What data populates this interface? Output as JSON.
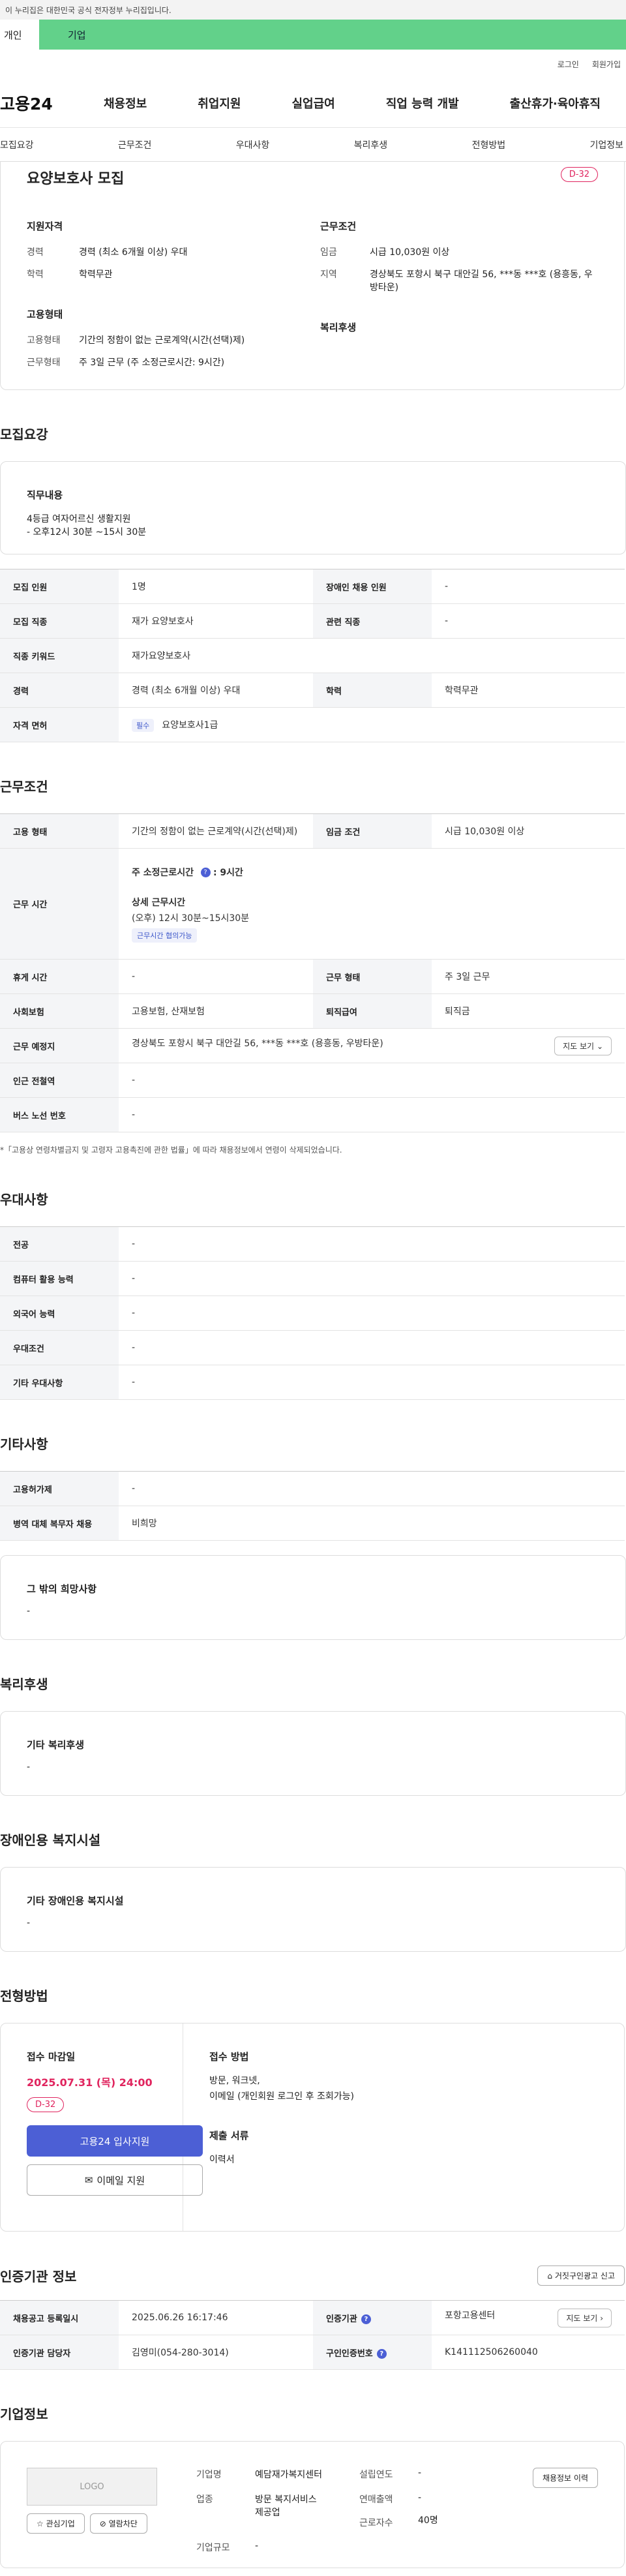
{
  "gov_banner": "이 누리집은 대한민국 공식 전자정부 누리집입니다.",
  "tabs": [
    "개인",
    "기업"
  ],
  "util": [
    "로그인",
    "회원가입"
  ],
  "logo": "고용24",
  "gnb": [
    "채용정보",
    "취업지원",
    "실업급여",
    "직업 능력 개발",
    "출산휴가·육아휴직"
  ],
  "subnav": [
    "모집요강",
    "근무조건",
    "우대사항",
    "복리후생",
    "전형방법",
    "기업정보"
  ],
  "job": {
    "title": "요양보호사 모집",
    "dday": "D-32",
    "qual_h": "지원자격",
    "qual": [
      {
        "k": "경력",
        "v": "경력 (최소 6개월 이상) 우대"
      },
      {
        "k": "학력",
        "v": "학력무관"
      }
    ],
    "cond_h": "근무조건",
    "cond": [
      {
        "k": "임금",
        "v": "시급 10,030원 이상"
      },
      {
        "k": "지역",
        "v": "경상북도 포항시 북구 대안길 56, ***동 ***호 (용흥동, 우방타운)"
      }
    ],
    "emp_h": "고용형태",
    "emp": [
      {
        "k": "고용형태",
        "v": "기간의 정함이 없는 근로계약(시간(선택)제)"
      },
      {
        "k": "근무형태",
        "v": "주 3일 근무 (주 소정근로시간: 9시간)"
      }
    ],
    "welfare_h": "복리후생"
  },
  "recruit": {
    "title": "모집요강",
    "duty_h": "직무내용",
    "duty_lines": [
      "4등급 여자어르신 생활지원",
      "- 오후12시 30분 ~15시 30분"
    ],
    "rows": [
      {
        "k1": "모집 인원",
        "v1": "1명",
        "k2": "장애인 채용 인원",
        "v2": "-"
      },
      {
        "k1": "모집 직종",
        "v1": "재가 요양보호사",
        "k2": "관련 직종",
        "v2": "-"
      },
      {
        "k1": "직종 키워드",
        "v1": "재가요양보호사"
      },
      {
        "k1": "경력",
        "v1": "경력 (최소 6개월 이상) 우대",
        "k2": "학력",
        "v2": "학력무관"
      },
      {
        "k1": "자격 면허",
        "badge": "필수",
        "v1": "요양보호사1급"
      }
    ]
  },
  "work": {
    "title": "근무조건",
    "emp_k": "고용 형태",
    "emp_v": "기간의 정함이 없는 근로계약(시간(선택)제)",
    "wage_k": "임금 조건",
    "wage_v": "시급 10,030원 이상",
    "time_k": "근무 시간",
    "time_a": "주 소정근로시간",
    "time_a_v": ": 9시간",
    "time_b": "상세 근무시간",
    "time_b_v": "(오후) 12시 30분~15시30분",
    "time_tag": "근무시간 협의가능",
    "rest_k": "휴게 시간",
    "rest_v": "-",
    "form_k": "근무 형태",
    "form_v": "주 3일 근무",
    "ins_k": "사회보험",
    "ins_v": "고용보험, 산재보험",
    "sev_k": "퇴직급여",
    "sev_v": "퇴직금",
    "loc_k": "근무 예정지",
    "loc_v": "경상북도 포항시 북구 대안길 56, ***동 ***호 (용흥동, 우방타운)",
    "map_btn": "지도 보기",
    "sub_k": "인근 전철역",
    "sub_v": "-",
    "bus_k": "버스 노선 번호",
    "bus_v": "-",
    "note": "*「고용상 연령차별금지 및 고령자 고용촉진에 관한 법률」에 따라 채용정보에서 연령이 삭제되었습니다."
  },
  "pref": {
    "title": "우대사항",
    "rows": [
      {
        "k": "전공",
        "v": "-"
      },
      {
        "k": "컴퓨터 활용 능력",
        "v": "-"
      },
      {
        "k": "외국어 능력",
        "v": "-"
      },
      {
        "k": "우대조건",
        "v": "-"
      },
      {
        "k": "기타 우대사항",
        "v": "-"
      }
    ]
  },
  "etc": {
    "title": "기타사항",
    "rows": [
      {
        "k": "고용허가제",
        "v": "-"
      },
      {
        "k": "병역 대체 복무자 채용",
        "v": "비희망"
      }
    ],
    "box_h": "그 밖의 희망사항",
    "box_v": "-"
  },
  "welfare": {
    "title": "복리후생",
    "box_h": "기타 복리후생",
    "box_v": "-"
  },
  "disab": {
    "title": "장애인용 복지시설",
    "box_h": "기타 장애인용 복지시설",
    "box_v": "-"
  },
  "process": {
    "title": "전형방법",
    "deadline_h": "접수 마감일",
    "deadline": "2025.07.31 (목) 24:00",
    "dday": "D-32",
    "apply_btn": "고용24 입사지원",
    "mail_btn": "이메일 지원",
    "method_h": "접수 방법",
    "method_lines": [
      "방문, 워크넷,",
      "이메일 (개인회원 로그인 후 조회가능)"
    ],
    "docs_h": "제출 서류",
    "docs_v": "이력서"
  },
  "agency": {
    "title": "인증기관 정보",
    "report_btn": "거짓구인광고 신고",
    "r1": {
      "k1": "채용공고 등록일시",
      "v1": "2025.06.26 16:17:46",
      "k2": "인증기관",
      "v2": "포항고용센터",
      "btn": "지도 보기"
    },
    "r2": {
      "k1": "인증기관 담당자",
      "v1": "김영미(054-280-3014)",
      "k2": "구인인증번호",
      "v2": "K141112506260040"
    }
  },
  "company": {
    "title": "기업정보",
    "logo": "LOGO",
    "fav_btn": "관심기업",
    "block_btn": "열람차단",
    "name_k": "기업명",
    "name_v": "예담재가복지센터",
    "year_k": "설립연도",
    "year_v": "-",
    "ind_k": "업종",
    "ind_lines": [
      "방문 복지서비스",
      "제공업"
    ],
    "sales_k": "연매출액",
    "sales_v": "-",
    "emp_k": "근로자수",
    "emp_v": "40명",
    "size_k": "기업규모",
    "size_v": "-",
    "hist_btn": "채용정보 이력"
  }
}
